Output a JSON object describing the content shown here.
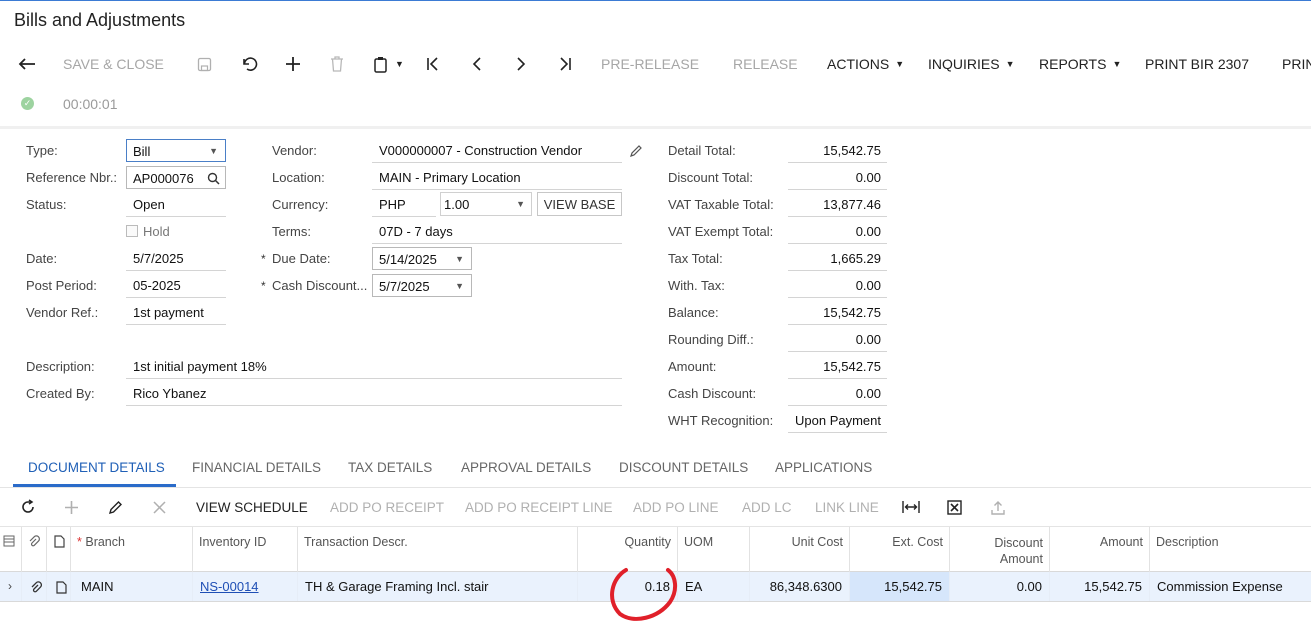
{
  "window": {
    "title": "Bills and Adjustments"
  },
  "toolbar": {
    "save_close": "SAVE & CLOSE",
    "pre_release": "PRE-RELEASE",
    "release": "RELEASE",
    "actions": "ACTIONS",
    "inquiries": "INQUIRIES",
    "reports": "REPORTS",
    "print_bir": "PRINT BIR 2307",
    "print_cut": "PRIN",
    "timer": "00:00:01"
  },
  "form": {
    "type_label": "Type:",
    "type_value": "Bill",
    "ref_label": "Reference Nbr.:",
    "ref_value": "AP000076",
    "status_label": "Status:",
    "status_value": "Open",
    "hold_label": "Hold",
    "date_label": "Date:",
    "date_value": "5/7/2025",
    "post_label": "Post Period:",
    "post_value": "05-2025",
    "vendref_label": "Vendor Ref.:",
    "vendref_value": "1st payment",
    "desc_label": "Description:",
    "desc_value": "1st initial payment 18%",
    "created_label": "Created By:",
    "created_value": "Rico Ybanez",
    "vendor_label": "Vendor:",
    "vendor_value": "V000000007 - Construction Vendor",
    "location_label": "Location:",
    "location_value": "MAIN - Primary Location",
    "currency_label": "Currency:",
    "currency_value": "PHP",
    "rate_value": "1.00",
    "view_base": "VIEW BASE",
    "terms_label": "Terms:",
    "terms_value": "07D - 7 days",
    "due_label": "Due Date:",
    "due_value": "5/14/2025",
    "cashdisc_label": "Cash Discount...",
    "cashdisc_value": "5/7/2025"
  },
  "totals": [
    {
      "label": "Detail Total:",
      "value": "15,542.75"
    },
    {
      "label": "Discount Total:",
      "value": "0.00"
    },
    {
      "label": "VAT Taxable Total:",
      "value": "13,877.46"
    },
    {
      "label": "VAT Exempt Total:",
      "value": "0.00"
    },
    {
      "label": "Tax Total:",
      "value": "1,665.29"
    },
    {
      "label": "With. Tax:",
      "value": "0.00"
    },
    {
      "label": "Balance:",
      "value": "15,542.75"
    },
    {
      "label": "Rounding Diff.:",
      "value": "0.00"
    },
    {
      "label": "Amount:",
      "value": "15,542.75"
    },
    {
      "label": "Cash Discount:",
      "value": "0.00"
    },
    {
      "label": "WHT Recognition:",
      "value": "Upon Payment"
    }
  ],
  "tabs": [
    "DOCUMENT DETAILS",
    "FINANCIAL DETAILS",
    "TAX DETAILS",
    "APPROVAL DETAILS",
    "DISCOUNT DETAILS",
    "APPLICATIONS"
  ],
  "grid_toolbar": {
    "view_schedule": "VIEW SCHEDULE",
    "add_po_receipt": "ADD PO RECEIPT",
    "add_po_receipt_line": "ADD PO RECEIPT LINE",
    "add_po_line": "ADD PO LINE",
    "add_lc": "ADD LC",
    "link_line": "LINK LINE"
  },
  "grid": {
    "headers": {
      "branch": "Branch",
      "inventory_id": "Inventory ID",
      "trans_descr": "Transaction Descr.",
      "quantity": "Quantity",
      "uom": "UOM",
      "unit_cost": "Unit Cost",
      "ext_cost": "Ext. Cost",
      "discount_line1": "Discount",
      "discount_line2": "Amount",
      "amount": "Amount",
      "description": "Description"
    },
    "rows": [
      {
        "branch": "MAIN",
        "inventory_id": "NS-00014",
        "trans_descr": "TH & Garage Framing Incl. stair",
        "quantity": "0.18",
        "uom": "EA",
        "unit_cost": "86,348.6300",
        "ext_cost": "15,542.75",
        "discount": "0.00",
        "amount": "15,542.75",
        "description": "Commission Expense"
      }
    ]
  },
  "colors": {
    "accent": "#2a6bc9",
    "annotation": "#e0202a",
    "row_highlight": "#eaf2fd"
  }
}
